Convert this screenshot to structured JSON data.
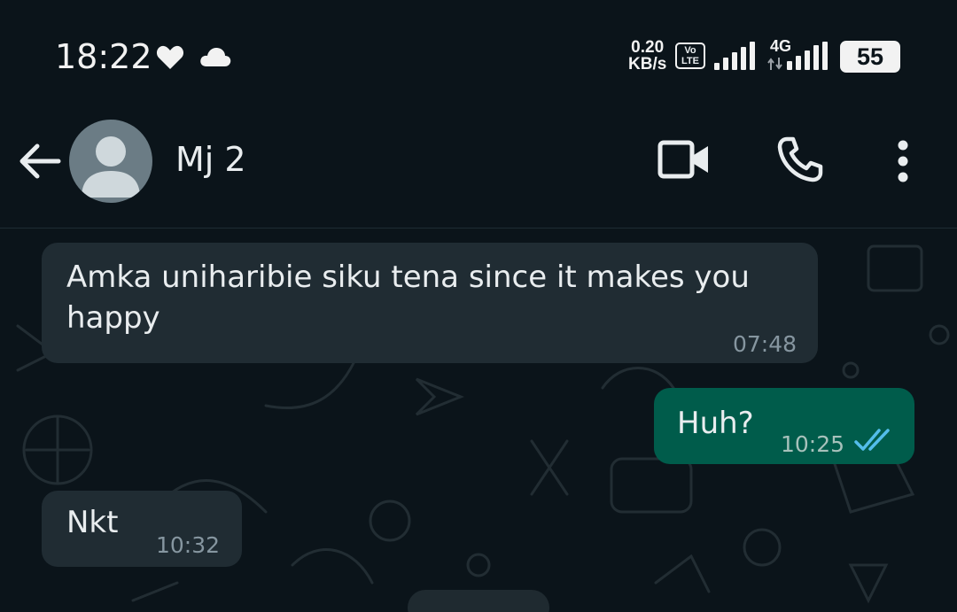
{
  "status_bar": {
    "time": "18:22",
    "net_speed_value": "0.20",
    "net_speed_unit": "KB/s",
    "volte_top": "Vo",
    "volte_bottom": "LTE",
    "network_type": "4G",
    "battery": "55",
    "icons": [
      "heart-icon",
      "cloud-icon",
      "signal-icon",
      "signal-icon"
    ]
  },
  "header": {
    "contact_name": "Mj 2",
    "icons": [
      "back-arrow-icon",
      "avatar-placeholder",
      "video-call-icon",
      "voice-call-icon",
      "more-options-icon"
    ]
  },
  "messages": [
    {
      "direction": "incoming",
      "lines": [
        "Amka uniharibie siku tena since it makes you",
        "happy"
      ],
      "time": "07:48"
    },
    {
      "direction": "outgoing",
      "text": "Huh?",
      "time": "10:25",
      "status": "read",
      "status_icon": "double-check-icon"
    },
    {
      "direction": "incoming",
      "text": "Nkt",
      "time": "10:32"
    }
  ],
  "colors": {
    "background": "#0b141a",
    "incoming_bubble": "#202c33",
    "outgoing_bubble": "#005c4b",
    "read_ticks": "#53bdeb",
    "text": "#e9edef",
    "timestamp": "#8696a0"
  }
}
